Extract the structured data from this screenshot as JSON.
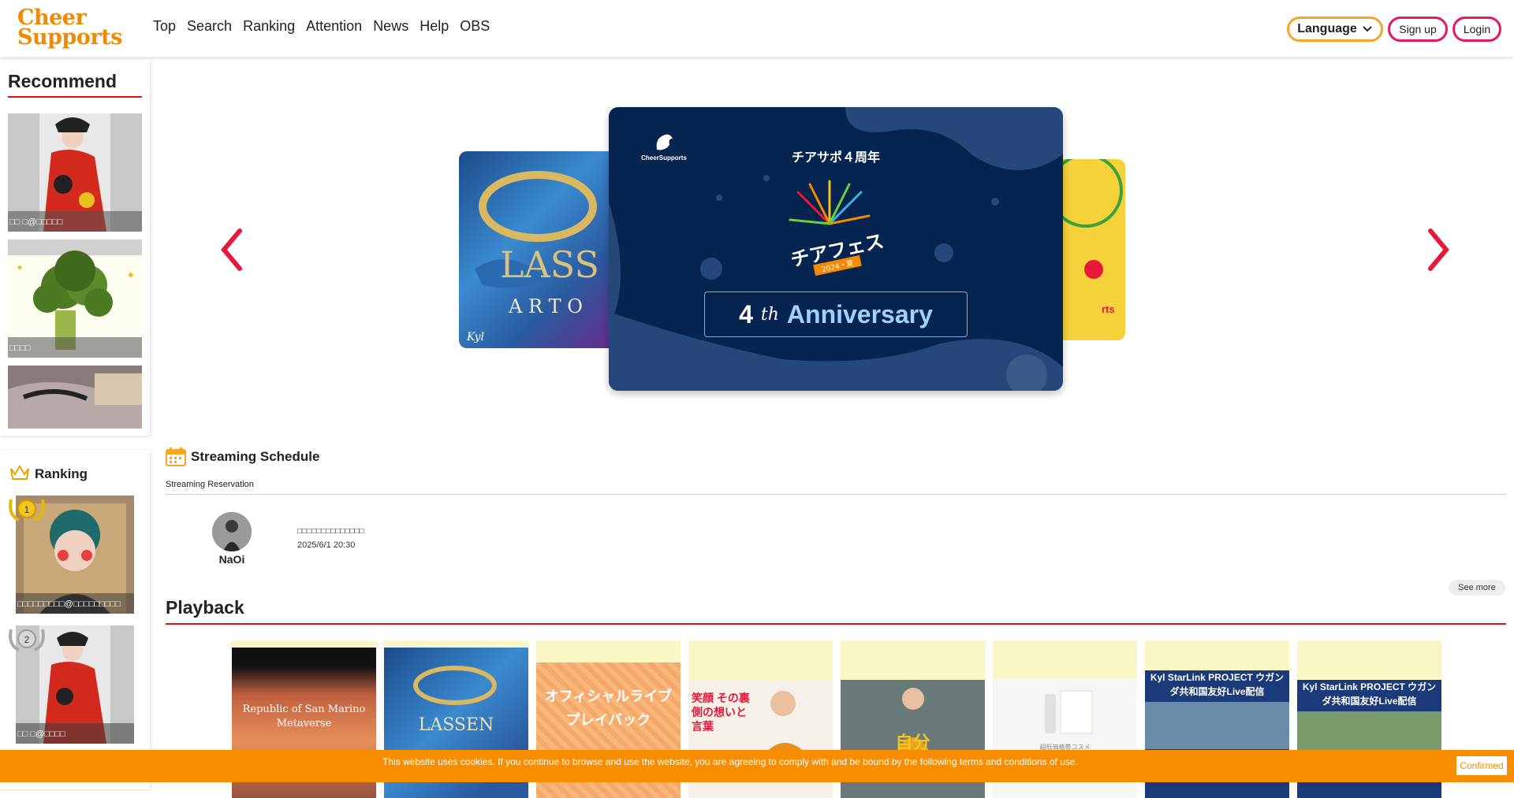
{
  "brand": {
    "line1": "Cheer",
    "line2": "Supports",
    "accent": "#f08a00"
  },
  "nav": [
    "Top",
    "Search",
    "Ranking",
    "Attention",
    "News",
    "Help",
    "OBS"
  ],
  "header": {
    "language": "Language",
    "signup": "Sign up",
    "login": "Login"
  },
  "recommend": {
    "title": "Recommend",
    "items": [
      {
        "label": "□□ □@□□□□□"
      },
      {
        "label": "□□□□"
      },
      {
        "label": ""
      }
    ]
  },
  "ranking": {
    "title": "Ranking",
    "items": [
      {
        "rank": "1",
        "label": "□□□□□□□□□@□□□□□□□□□"
      },
      {
        "rank": "2",
        "label": "□□ □@□□□□"
      }
    ]
  },
  "banner": {
    "logo": "CheerSupports",
    "title": "チアサポ４周年",
    "fest_text": "チアフェス",
    "fest_sub": "2024・夏",
    "anniversary_num": "4",
    "anniversary_suffix": "th",
    "anniversary_word": "Anniversary",
    "left_word1": "LASS",
    "left_word2": "A R T  O",
    "left_sig": "Kyl",
    "right_word": "rts"
  },
  "schedule": {
    "title": "Streaming Schedule",
    "subtitle": "Streaming Reservation",
    "entry": {
      "name": "NaOi",
      "title": "□□□□□□□□□□□□□□",
      "date": "2025/6/1 20:30"
    },
    "see_more": "See more"
  },
  "playback": {
    "title": "Playback",
    "items": [
      {
        "text": "Republic of San Marino Metaverse"
      },
      {
        "text": "LASSEN"
      },
      {
        "text": "オフィシャルライブ プレイバック"
      },
      {
        "text": "笑顔 その裏側の想いと言葉"
      },
      {
        "text": "自分"
      },
      {
        "text": "超低価格帯コスメ"
      },
      {
        "text": "Kyl StarLink PROJECT ウガンダ共和国友好Live配信"
      },
      {
        "text": "Kyl StarLink PROJECT ウガンダ共和国友好Live配信"
      }
    ]
  },
  "cookie": {
    "text": "This website uses cookies. If you continue to browse and use the website, you are agreeing to comply with and be bound by the following terms and conditions of use.",
    "button": "Confirmed"
  }
}
